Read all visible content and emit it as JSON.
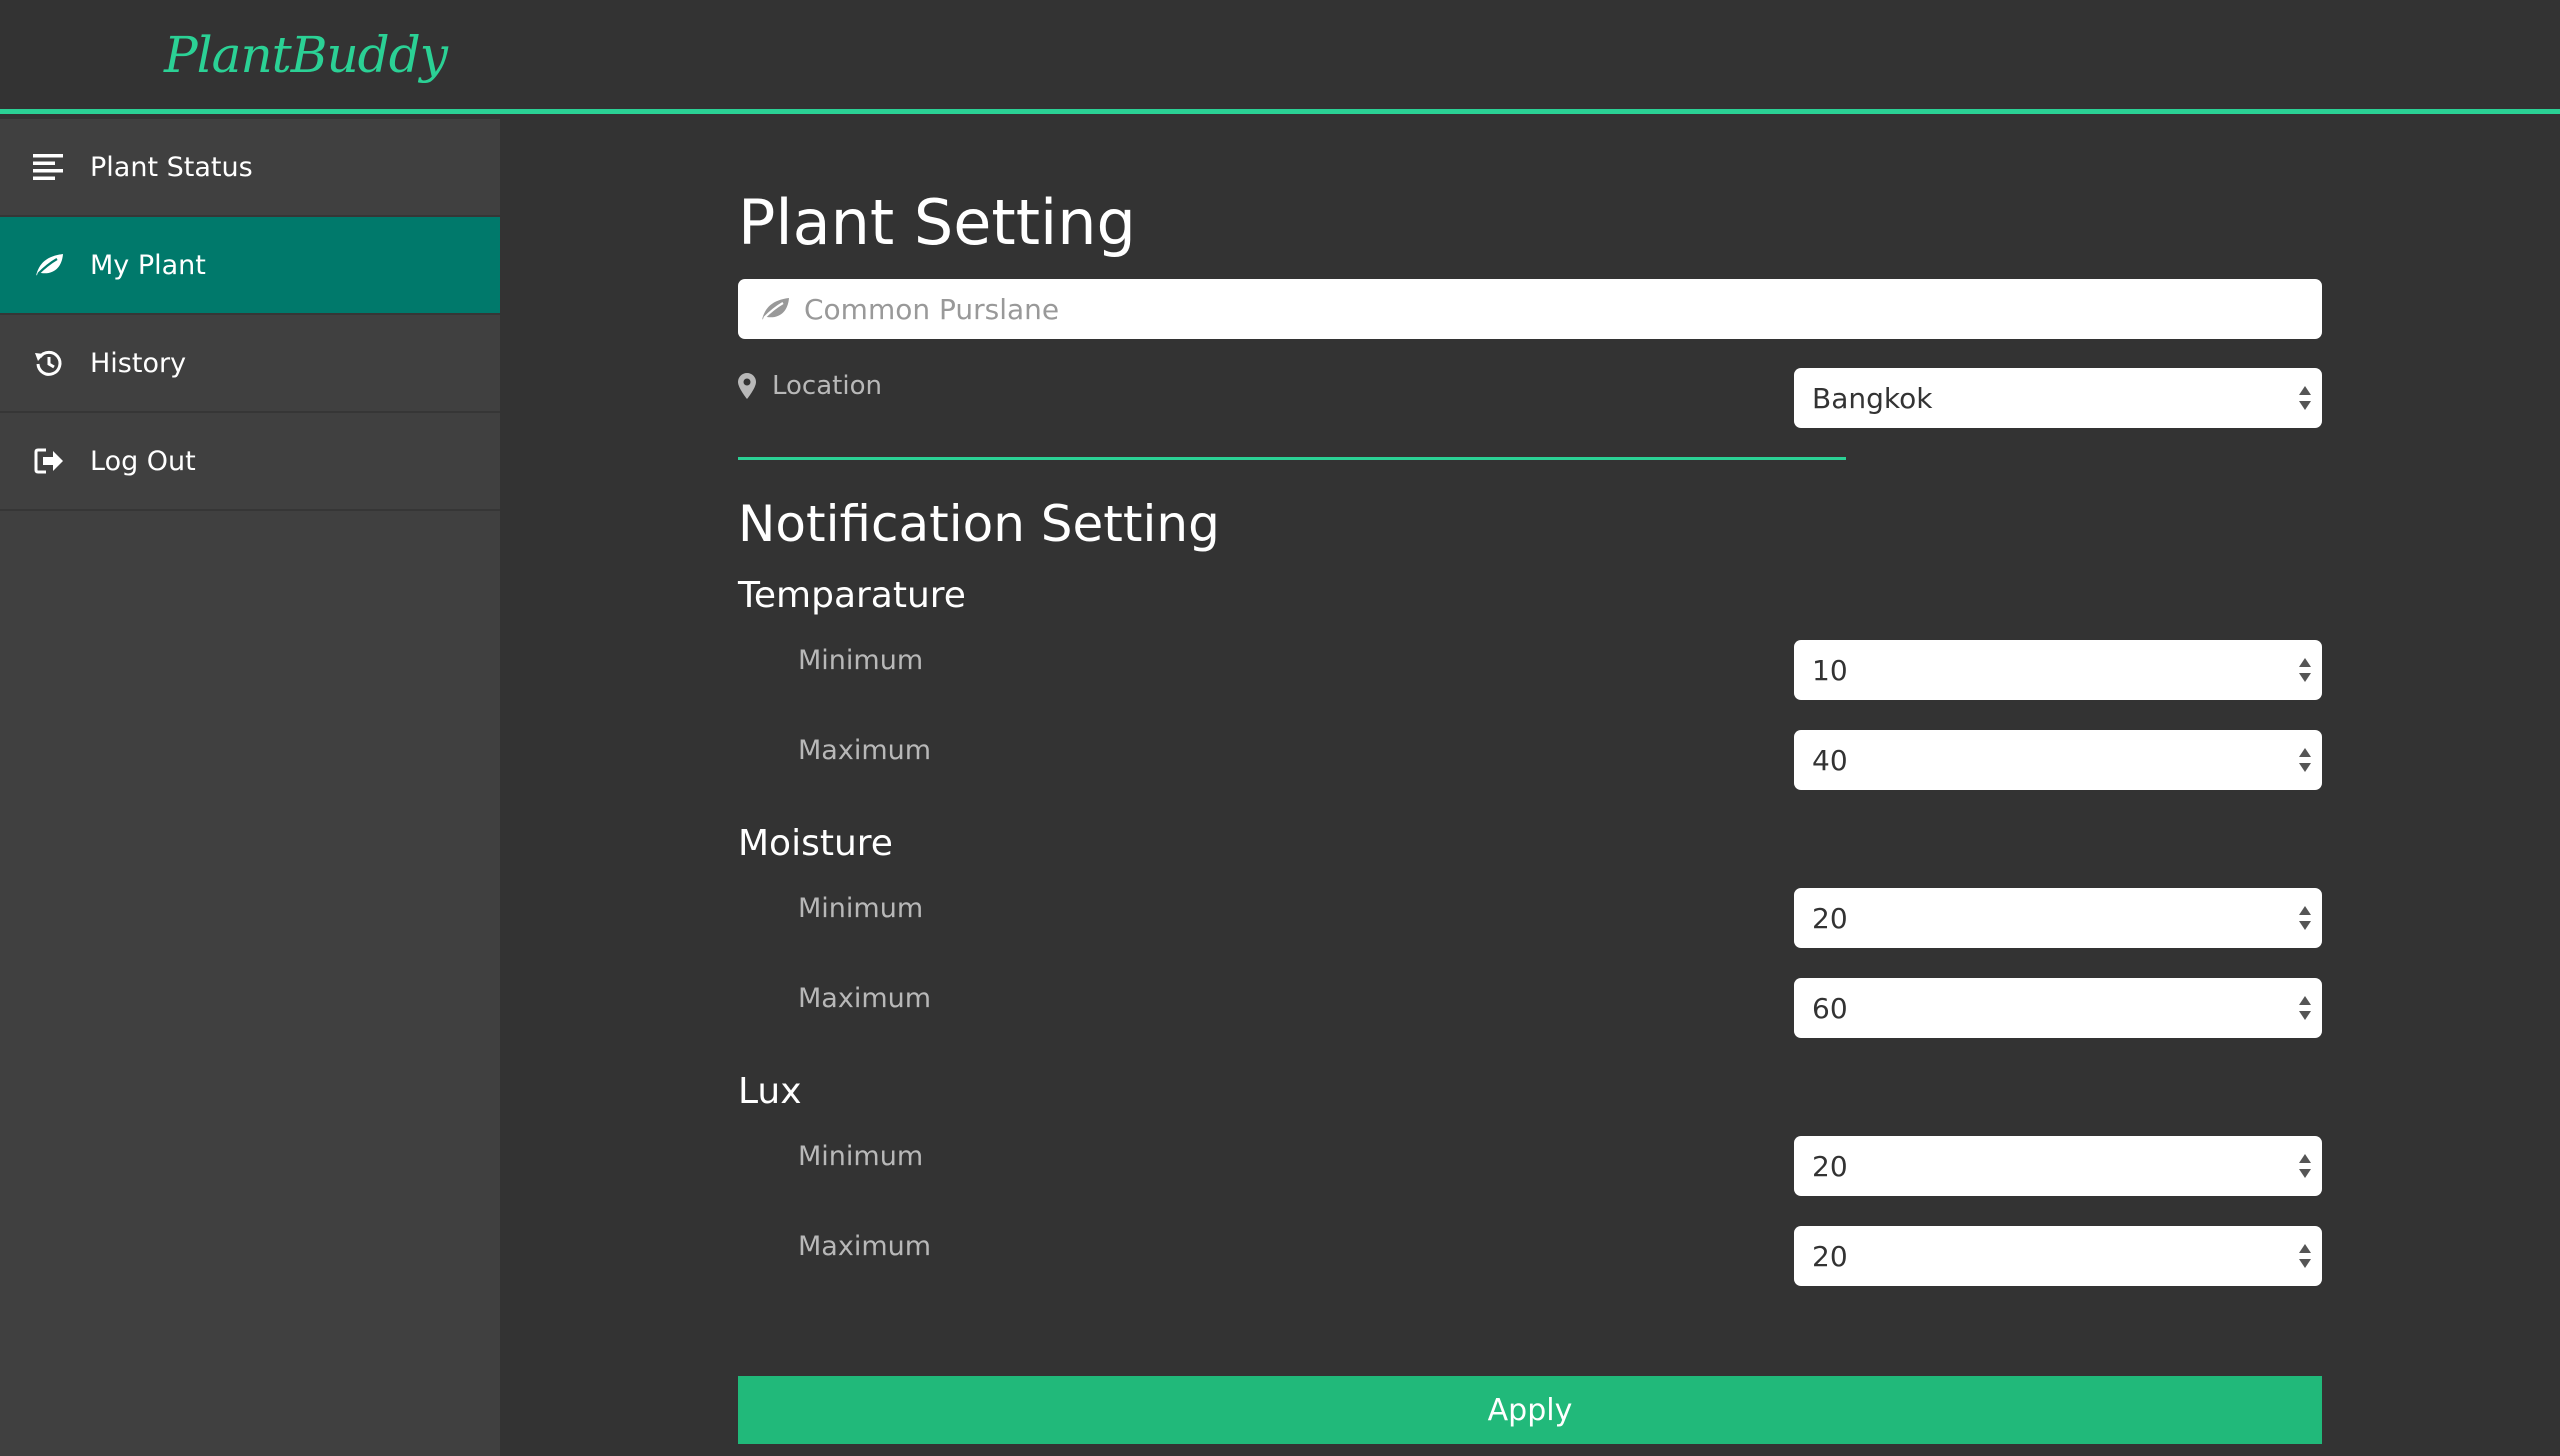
{
  "app": {
    "logo": "PlantBuddy"
  },
  "colors": {
    "accent": "#2bd195",
    "active_nav": "#00796b",
    "apply_button": "#21b97a",
    "background": "#333333",
    "sidebar": "#404040"
  },
  "sidebar": {
    "items": [
      {
        "label": "Plant Status",
        "icon": "align-left-icon",
        "active": false
      },
      {
        "label": "My Plant",
        "icon": "leaf-icon",
        "active": true
      },
      {
        "label": "History",
        "icon": "history-icon",
        "active": false
      },
      {
        "label": "Log Out",
        "icon": "sign-out-icon",
        "active": false
      }
    ]
  },
  "plant_setting": {
    "title": "Plant Setting",
    "plant_name": "Common Purslane",
    "location_label": "Location",
    "location_value": "Bangkok"
  },
  "notification": {
    "title": "Notification Setting",
    "temperature": {
      "label": "Temparature",
      "min_label": "Minimum",
      "min_value": "10",
      "max_label": "Maximum",
      "max_value": "40"
    },
    "moisture": {
      "label": "Moisture",
      "min_label": "Minimum",
      "min_value": "20",
      "max_label": "Maximum",
      "max_value": "60"
    },
    "lux": {
      "label": "Lux",
      "min_label": "Minimum",
      "min_value": "20",
      "max_label": "Maximum",
      "max_value": "20"
    }
  },
  "apply_label": "Apply"
}
